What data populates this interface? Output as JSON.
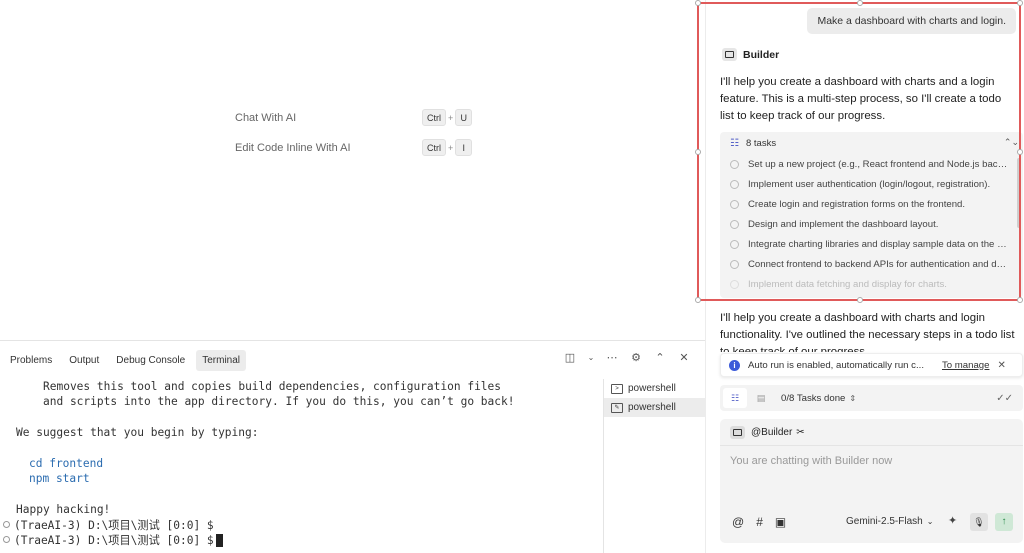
{
  "welcome": {
    "shortcuts": [
      {
        "label": "Chat With AI",
        "keys": [
          "Ctrl",
          "U"
        ]
      },
      {
        "label": "Edit Code Inline With AI",
        "keys": [
          "Ctrl",
          "I"
        ]
      }
    ]
  },
  "panel": {
    "tabs": [
      "Problems",
      "Output",
      "Debug Console",
      "Terminal"
    ],
    "active_tab": "Terminal",
    "terminal_lines": [
      "Removes this tool and copies build dependencies, configuration files",
      "and scripts into the app directory. If you do this, you can’t go back!",
      "",
      "We suggest that you begin by typing:",
      "",
      "cd frontend",
      "npm start",
      "",
      "Happy hacking!",
      "(TraeAI-3) D:\\项目\\测试 [0:0] $",
      "(TraeAI-3) D:\\项目\\测试 [0:0] $"
    ],
    "terminals": [
      "powershell",
      "powershell"
    ]
  },
  "chat": {
    "user_message": "Make a dashboard with charts and login.",
    "agent_name": "Builder",
    "agent_intro": "I'll help you create a dashboard with charts and a login feature. This is a multi-step process, so I'll create a todo list to keep track of our progress.",
    "tasks_label": "8 tasks",
    "tasks": [
      "Set up a new project (e.g., React frontend and Node.js backend).",
      "Implement user authentication (login/logout, registration).",
      "Create login and registration forms on the frontend.",
      "Design and implement the dashboard layout.",
      "Integrate charting libraries and display sample data on the dashboard.",
      "Connect frontend to backend APIs for authentication and data.",
      "Implement data fetching and display for charts."
    ],
    "agent_followup": "I'll help you create a dashboard with charts and login functionality. I've outlined the necessary steps in a todo list to keep track of our progress.",
    "notice_text": "Auto run is enabled, automatically run c...",
    "notice_link": "To manage",
    "tasks_done": "0/8 Tasks done",
    "mention": "@Builder",
    "input_placeholder": "You are chatting with Builder now",
    "model": "Gemini-2.5-Flash"
  }
}
